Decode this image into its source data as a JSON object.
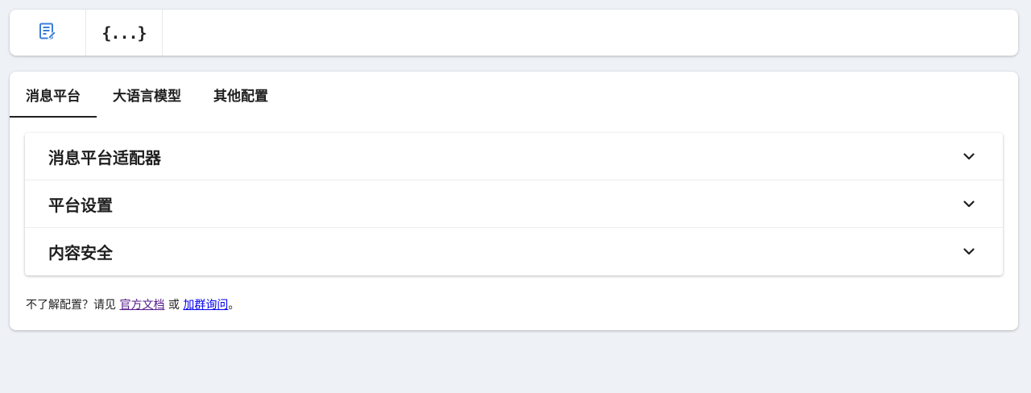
{
  "toolbar": {
    "buttons": [
      {
        "icon": "edit-document-icon",
        "label": ""
      },
      {
        "icon": "json-code-icon",
        "label": "{...}"
      }
    ],
    "accent_color": "#3b7ddd"
  },
  "tabs": [
    {
      "label": "消息平台",
      "active": true
    },
    {
      "label": "大语言模型",
      "active": false
    },
    {
      "label": "其他配置",
      "active": false
    }
  ],
  "sections": [
    {
      "title": "消息平台适配器",
      "expanded": false
    },
    {
      "title": "平台设置",
      "expanded": false
    },
    {
      "title": "内容安全",
      "expanded": false
    }
  ],
  "footer": {
    "prefix": "不了解配置？请见 ",
    "docs_link": "官方文档",
    "middle": " 或 ",
    "group_link": "加群询问",
    "suffix": "。"
  }
}
